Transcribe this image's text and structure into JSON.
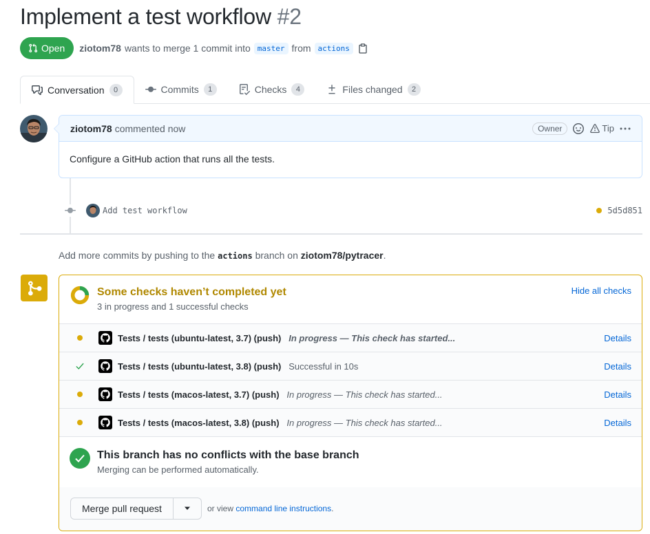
{
  "pr": {
    "title": "Implement a test workflow",
    "number": "#2",
    "state": "Open",
    "author": "ziotom78",
    "merge_text": "wants to merge 1 commit into",
    "base_branch": "master",
    "from_text": "from",
    "head_branch": "actions"
  },
  "tabs": [
    {
      "label": "Conversation",
      "count": "0",
      "icon": "comment-discussion-icon"
    },
    {
      "label": "Commits",
      "count": "1",
      "icon": "git-commit-icon"
    },
    {
      "label": "Checks",
      "count": "4",
      "icon": "checklist-icon"
    },
    {
      "label": "Files changed",
      "count": "2",
      "icon": "diff-icon"
    }
  ],
  "comment": {
    "author": "ziotom78",
    "action": "commented now",
    "badge": "Owner",
    "tip": "Tip",
    "body": "Configure a GitHub action that runs all the tests."
  },
  "commit": {
    "message": "Add test workflow",
    "sha": "5d5d851"
  },
  "push_hint": {
    "prefix": "Add more commits by pushing to the",
    "branch": "actions",
    "middle": "branch on",
    "repo": "ziotom78/pytracer",
    "suffix": "."
  },
  "checks": {
    "title": "Some checks haven’t completed yet",
    "subtitle": "3 in progress and 1 successful checks",
    "hide_label": "Hide all checks",
    "items": [
      {
        "name": "Tests / tests (ubuntu-latest, 3.7) (push)",
        "status": "pending",
        "desc": "In progress — This check has started...",
        "details": "Details"
      },
      {
        "name": "Tests / tests (ubuntu-latest, 3.8) (push)",
        "status": "success",
        "desc": "Successful in 10s",
        "details": "Details"
      },
      {
        "name": "Tests / tests (macos-latest, 3.7) (push)",
        "status": "pending",
        "desc": "In progress — This check has started...",
        "details": "Details"
      },
      {
        "name": "Tests / tests (macos-latest, 3.8) (push)",
        "status": "pending",
        "desc": "In progress — This check has started...",
        "details": "Details"
      }
    ]
  },
  "conflicts": {
    "title": "This branch has no conflicts with the base branch",
    "subtitle": "Merging can be performed automatically."
  },
  "merge": {
    "button": "Merge pull request",
    "or_view": "or view",
    "cli_link": "command line instructions",
    "period": "."
  },
  "colors": {
    "open_green": "#2ea44f",
    "pending_yellow": "#dbab09",
    "link_blue": "#0366d6"
  }
}
